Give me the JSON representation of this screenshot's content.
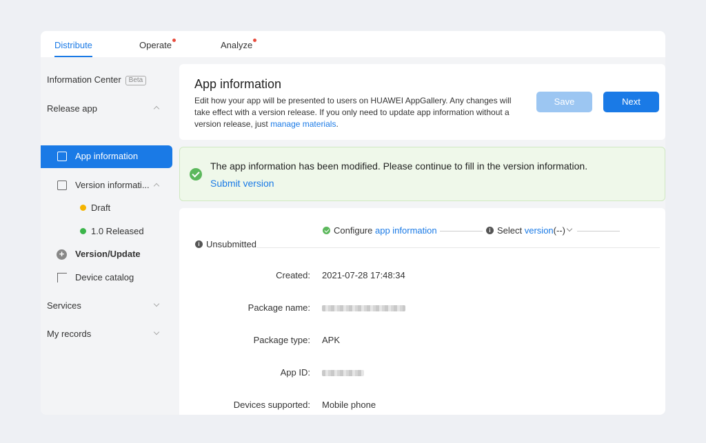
{
  "topnav": {
    "tabs": [
      {
        "label": "Distribute",
        "active": true,
        "dot": false
      },
      {
        "label": "Operate",
        "active": false,
        "dot": true
      },
      {
        "label": "Analyze",
        "active": false,
        "dot": true
      }
    ]
  },
  "sidebar": {
    "info_center": "Information Center",
    "beta": "Beta",
    "release_app": "Release app",
    "app_information": "App information",
    "version_information": "Version informati...",
    "draft": "Draft",
    "released": "1.0 Released",
    "version_update": "Version/Update",
    "device_catalog": "Device catalog",
    "services": "Services",
    "my_records": "My records"
  },
  "header": {
    "title": "App information",
    "desc_part1": "Edit how your app will be presented to users on HUAWEI AppGallery. Any changes will take effect with a version release. If you only need to update app information without a version release, just ",
    "desc_link": "manage materials",
    "desc_end": ".",
    "save_label": "Save",
    "next_label": "Next"
  },
  "banner": {
    "message": "The app information has been modified. Please continue to fill in the version information.",
    "link": "Submit version"
  },
  "steps": {
    "status": "Unsubmitted",
    "step1_prefix": "Configure ",
    "step1_link": "app information",
    "step2_prefix": "Select ",
    "step2_link": "version",
    "step2_suffix": "(--)"
  },
  "fields": [
    {
      "label": "Created:",
      "value": "2021-07-28 17:48:34"
    },
    {
      "label": "Package name:",
      "value": ""
    },
    {
      "label": "Package type:",
      "value": "APK"
    },
    {
      "label": "App ID:",
      "value": ""
    },
    {
      "label": "Devices supported:",
      "value": "Mobile phone"
    }
  ],
  "colors": {
    "accent": "#1a7ae6",
    "success": "#5cb85c",
    "draft": "#f5b400",
    "released": "#3bb54a"
  }
}
